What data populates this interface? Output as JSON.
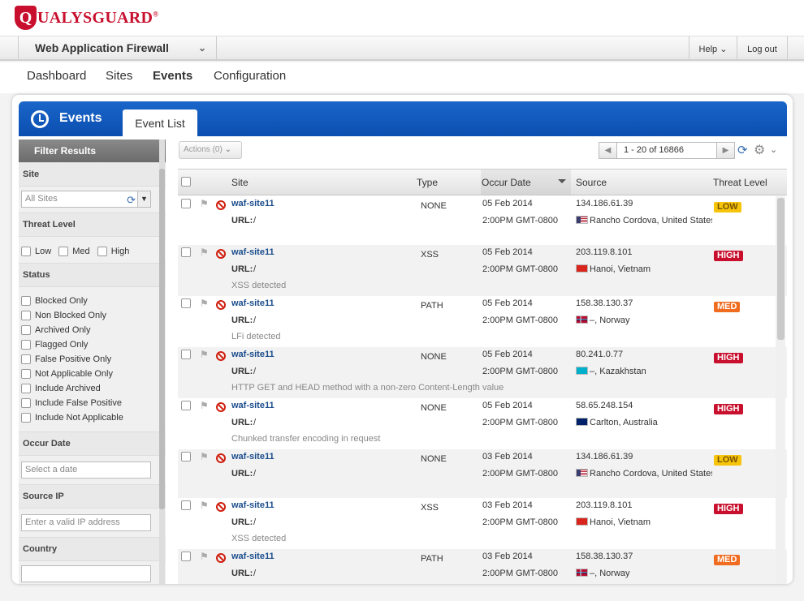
{
  "brand": {
    "name_q": "Q",
    "name_rest": "UALYSGUARD",
    "reg": "®"
  },
  "app": {
    "name": "Web Application Firewall"
  },
  "header": {
    "help_label": "Help",
    "logout_label": "Log out"
  },
  "nav": [
    {
      "label": "Dashboard",
      "active": false
    },
    {
      "label": "Sites",
      "active": false
    },
    {
      "label": "Events",
      "active": true
    },
    {
      "label": "Configuration",
      "active": false
    }
  ],
  "panel": {
    "title": "Events",
    "tab": "Event List"
  },
  "sidebar": {
    "title": "Filter Results",
    "site": {
      "label": "Site",
      "value": "All Sites"
    },
    "threat": {
      "label": "Threat Level",
      "options": [
        "Low",
        "Med",
        "High"
      ]
    },
    "status": {
      "label": "Status",
      "options": [
        "Blocked Only",
        "Non Blocked Only",
        "Archived Only",
        "Flagged Only",
        "False Positive Only",
        "Not Applicable Only",
        "Include Archived",
        "Include False Positive",
        "Include Not Applicable"
      ]
    },
    "occur": {
      "label": "Occur Date",
      "placeholder": "Select a date"
    },
    "source_ip": {
      "label": "Source IP",
      "placeholder": "Enter a valid IP address"
    },
    "country": {
      "label": "Country"
    }
  },
  "toolbar": {
    "actions_label": "Actions (0)",
    "pager_range": "1 - 20 of 16866"
  },
  "table": {
    "headers": {
      "site": "Site",
      "type": "Type",
      "occur_date": "Occur Date",
      "source": "Source",
      "threat": "Threat Level"
    },
    "url_label": "URL:",
    "rows": [
      {
        "site": "waf-site11",
        "url": "/",
        "desc": "",
        "type": "NONE",
        "date": "05 Feb 2014",
        "time": "2:00PM GMT-0800",
        "ip": "134.186.61.39",
        "location": "Rancho Cordova, United States",
        "flag": "us",
        "threat": "LOW"
      },
      {
        "site": "waf-site11",
        "url": "/",
        "desc": "XSS detected",
        "type": "XSS",
        "date": "05 Feb 2014",
        "time": "2:00PM GMT-0800",
        "ip": "203.119.8.101",
        "location": "Hanoi, Vietnam",
        "flag": "vn",
        "threat": "HIGH"
      },
      {
        "site": "waf-site11",
        "url": "/",
        "desc": "LFi detected",
        "type": "PATH",
        "date": "05 Feb 2014",
        "time": "2:00PM GMT-0800",
        "ip": "158.38.130.37",
        "location": "–, Norway",
        "flag": "no",
        "threat": "MED"
      },
      {
        "site": "waf-site11",
        "url": "/",
        "desc": "HTTP GET and HEAD method with a non-zero Content-Length value",
        "type": "NONE",
        "date": "05 Feb 2014",
        "time": "2:00PM GMT-0800",
        "ip": "80.241.0.77",
        "location": "–, Kazakhstan",
        "flag": "kz",
        "threat": "HIGH"
      },
      {
        "site": "waf-site11",
        "url": "/",
        "desc": "Chunked transfer encoding in request",
        "type": "NONE",
        "date": "05 Feb 2014",
        "time": "2:00PM GMT-0800",
        "ip": "58.65.248.154",
        "location": "Carlton, Australia",
        "flag": "au",
        "threat": "HIGH"
      },
      {
        "site": "waf-site11",
        "url": "/",
        "desc": "",
        "type": "NONE",
        "date": "03 Feb 2014",
        "time": "2:00PM GMT-0800",
        "ip": "134.186.61.39",
        "location": "Rancho Cordova, United States",
        "flag": "us",
        "threat": "LOW"
      },
      {
        "site": "waf-site11",
        "url": "/",
        "desc": "XSS detected",
        "type": "XSS",
        "date": "03 Feb 2014",
        "time": "2:00PM GMT-0800",
        "ip": "203.119.8.101",
        "location": "Hanoi, Vietnam",
        "flag": "vn",
        "threat": "HIGH"
      },
      {
        "site": "waf-site11",
        "url": "/",
        "desc": "",
        "type": "PATH",
        "date": "03 Feb 2014",
        "time": "2:00PM GMT-0800",
        "ip": "158.38.130.37",
        "location": "–, Norway",
        "flag": "no",
        "threat": "MED"
      }
    ]
  },
  "colors": {
    "brand_red": "#c8102e",
    "header_blue": "#0b4eb0",
    "link_blue": "#1a4c8c",
    "low": "#f6c40a",
    "med": "#ef6c20",
    "high": "#c8102e"
  }
}
